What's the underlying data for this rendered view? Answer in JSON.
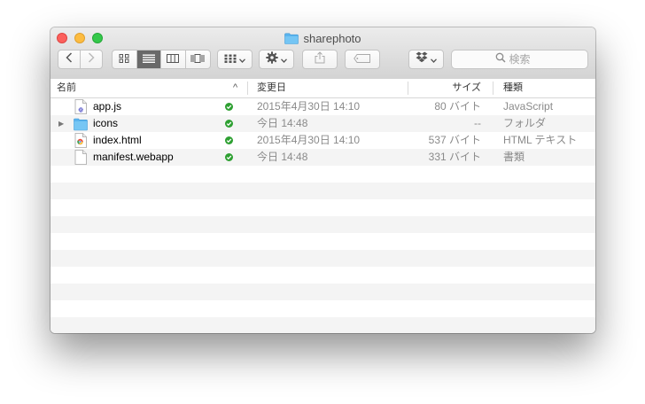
{
  "window": {
    "title": "sharephoto"
  },
  "toolbar": {
    "search_placeholder": "検索"
  },
  "columns": {
    "name": "名前",
    "date": "変更日",
    "size": "サイズ",
    "kind": "種類",
    "sort_indicator": "^"
  },
  "files": [
    {
      "name": "app.js",
      "date": "2015年4月30日 14:10",
      "size": "80 バイト",
      "kind": "JavaScript",
      "icon": "javascript-file-icon",
      "synced": true
    },
    {
      "name": "icons",
      "date": "今日 14:48",
      "size": "--",
      "kind": "フォルダ",
      "icon": "folder-icon",
      "synced": true,
      "expandable": true
    },
    {
      "name": "index.html",
      "date": "2015年4月30日 14:10",
      "size": "537 バイト",
      "kind": "HTML テキスト",
      "icon": "html-file-icon",
      "synced": true
    },
    {
      "name": "manifest.webapp",
      "date": "今日 14:48",
      "size": "331 バイト",
      "kind": "書類",
      "icon": "document-file-icon",
      "synced": true
    }
  ],
  "disclosure_glyph": "▶",
  "colors": {
    "close": "#fc605c",
    "minimize": "#fdbc40",
    "zoom": "#34c84a",
    "folder": "#5ab4ee",
    "sync_ok": "#2ea032",
    "row_alt": "#f4f4f4"
  }
}
